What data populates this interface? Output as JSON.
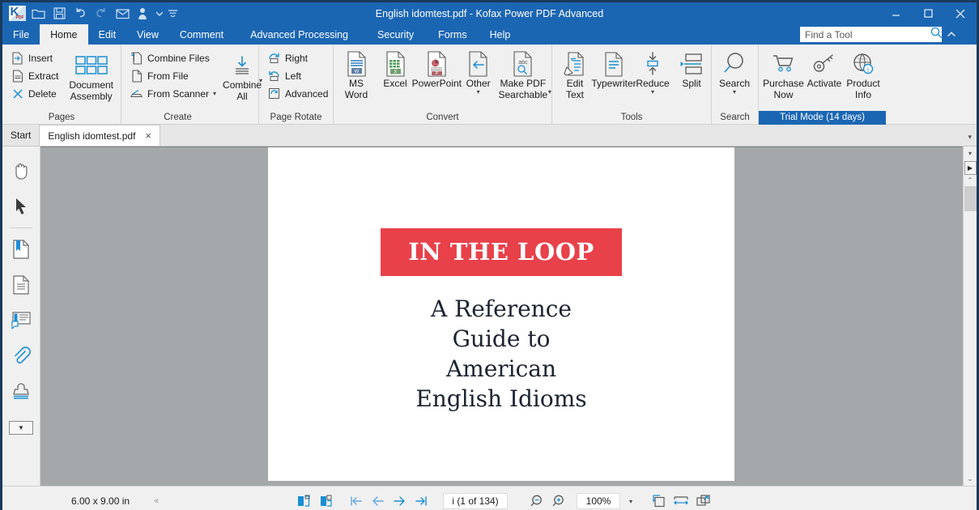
{
  "window": {
    "title": "English idomtest.pdf - Kofax Power PDF Advanced",
    "minimize_label": "Minimize",
    "maximize_label": "Maximize",
    "close_label": "Close"
  },
  "quick_access": {
    "items": [
      {
        "name": "app-logo",
        "label": "Kofax PDF"
      },
      {
        "name": "open-icon",
        "label": "Open"
      },
      {
        "name": "save-icon",
        "label": "Save"
      },
      {
        "name": "undo-icon",
        "label": "Undo"
      },
      {
        "name": "redo-icon",
        "label": "Redo"
      },
      {
        "name": "email-icon",
        "label": "Email"
      },
      {
        "name": "user-icon",
        "label": "User"
      },
      {
        "name": "qat-more-icon",
        "label": "Customize Quick Access Toolbar"
      }
    ]
  },
  "menu": {
    "tabs": [
      {
        "label": "File",
        "active": false
      },
      {
        "label": "Home",
        "active": true
      },
      {
        "label": "Edit",
        "active": false
      },
      {
        "label": "View",
        "active": false
      },
      {
        "label": "Comment",
        "active": false
      },
      {
        "label": "Advanced Processing",
        "active": false
      },
      {
        "label": "Security",
        "active": false
      },
      {
        "label": "Forms",
        "active": false
      },
      {
        "label": "Help",
        "active": false
      }
    ]
  },
  "search": {
    "placeholder": "Find a Tool",
    "value": ""
  },
  "ribbon": {
    "groups": [
      {
        "label": "Pages",
        "small_buttons": [
          {
            "label": "Insert",
            "icon": "page-insert-icon"
          },
          {
            "label": "Extract",
            "icon": "page-extract-icon"
          },
          {
            "label": "Delete",
            "icon": "page-delete-icon"
          }
        ],
        "big_buttons": [
          {
            "label": "Document Assembly",
            "icon": "document-assembly-icon"
          }
        ]
      },
      {
        "label": "Create",
        "small_buttons": [
          {
            "label": "Combine Files",
            "icon": "combine-files-icon"
          },
          {
            "label": "From File",
            "icon": "from-file-icon"
          },
          {
            "label": "From Scanner",
            "icon": "from-scanner-icon",
            "caret": true
          }
        ],
        "big_buttons": [
          {
            "label": "Combine All",
            "icon": "combine-all-icon",
            "caret": true
          }
        ]
      },
      {
        "label": "Page Rotate",
        "small_buttons": [
          {
            "label": "Right",
            "icon": "rotate-right-icon"
          },
          {
            "label": "Left",
            "icon": "rotate-left-icon"
          },
          {
            "label": "Advanced",
            "icon": "rotate-advanced-icon"
          }
        ],
        "big_buttons": []
      },
      {
        "label": "Convert",
        "small_buttons": [],
        "big_buttons": [
          {
            "label": "MS Word",
            "icon": "ms-word-icon"
          },
          {
            "label": "Excel",
            "icon": "excel-icon"
          },
          {
            "label": "PowerPoint",
            "icon": "powerpoint-icon"
          },
          {
            "label": "Other",
            "icon": "other-convert-icon",
            "caret": true
          },
          {
            "label": "Make PDF Searchable",
            "icon": "make-pdf-searchable-icon",
            "caret": true
          }
        ]
      },
      {
        "label": "Tools",
        "small_buttons": [],
        "big_buttons": [
          {
            "label": "Edit Text",
            "icon": "edit-text-icon"
          },
          {
            "label": "Typewriter",
            "icon": "typewriter-icon"
          },
          {
            "label": "Reduce",
            "icon": "reduce-icon",
            "caret": true
          },
          {
            "label": "Split",
            "icon": "split-icon"
          }
        ]
      },
      {
        "label": "Search",
        "small_buttons": [],
        "big_buttons": [
          {
            "label": "Search",
            "icon": "search-icon",
            "caret": true
          }
        ]
      },
      {
        "label": "Trial Mode (14 days)",
        "label_highlight": true,
        "small_buttons": [],
        "big_buttons": [
          {
            "label": "Purchase Now",
            "icon": "cart-icon"
          },
          {
            "label": "Activate",
            "icon": "key-icon"
          },
          {
            "label": "Product Info",
            "icon": "product-info-icon"
          }
        ]
      }
    ]
  },
  "doc_tabs": {
    "start_label": "Start",
    "open_label": "English idomtest.pdf",
    "close_glyph": "×",
    "overflow_glyph": "▾"
  },
  "left_toolbar": {
    "items": [
      {
        "name": "hand-tool-icon",
        "label": "Hand Tool"
      },
      {
        "name": "select-tool-icon",
        "label": "Select Tool"
      },
      {
        "name": "bookmarks-panel-icon",
        "label": "Bookmarks"
      },
      {
        "name": "pages-panel-icon",
        "label": "Pages"
      },
      {
        "name": "comments-panel-icon",
        "label": "Comments"
      },
      {
        "name": "attachments-panel-icon",
        "label": "Attachments"
      },
      {
        "name": "stamps-panel-icon",
        "label": "Stamps"
      },
      {
        "name": "more-panels-icon",
        "label": "More Panels"
      }
    ]
  },
  "document": {
    "banner_title": "IN THE LOOP",
    "subtitle_lines": [
      "A Reference",
      "Guide to",
      "American",
      "English Idioms"
    ],
    "banner_color": "#e8414a",
    "text_color": "#1c2331"
  },
  "status_bar": {
    "page_size": "6.00 x 9.00 in",
    "collapse_glyph": "«",
    "page_indicator": "i (1 of 134)",
    "zoom_value": "100%",
    "buttons": [
      {
        "name": "single-page-view-icon",
        "label": "Single Page View"
      },
      {
        "name": "facing-page-view-icon",
        "label": "Facing Page View"
      },
      {
        "name": "first-page-icon",
        "label": "First Page"
      },
      {
        "name": "previous-page-icon",
        "label": "Previous Page"
      },
      {
        "name": "next-page-icon",
        "label": "Next Page"
      },
      {
        "name": "last-page-icon",
        "label": "Last Page"
      },
      {
        "name": "zoom-out-icon",
        "label": "Zoom Out"
      },
      {
        "name": "zoom-in-icon",
        "label": "Zoom In"
      },
      {
        "name": "zoom-dropdown-icon",
        "label": "Zoom Presets"
      },
      {
        "name": "fit-page-icon",
        "label": "Fit Page"
      },
      {
        "name": "fit-width-icon",
        "label": "Fit Width"
      },
      {
        "name": "fit-visible-icon",
        "label": "Fit Visible"
      }
    ]
  },
  "scrollbar": {
    "up_glyph": "▾",
    "page_glyph": "▶",
    "small_up_glyph": "⌃",
    "down_glyph": "⌄"
  }
}
